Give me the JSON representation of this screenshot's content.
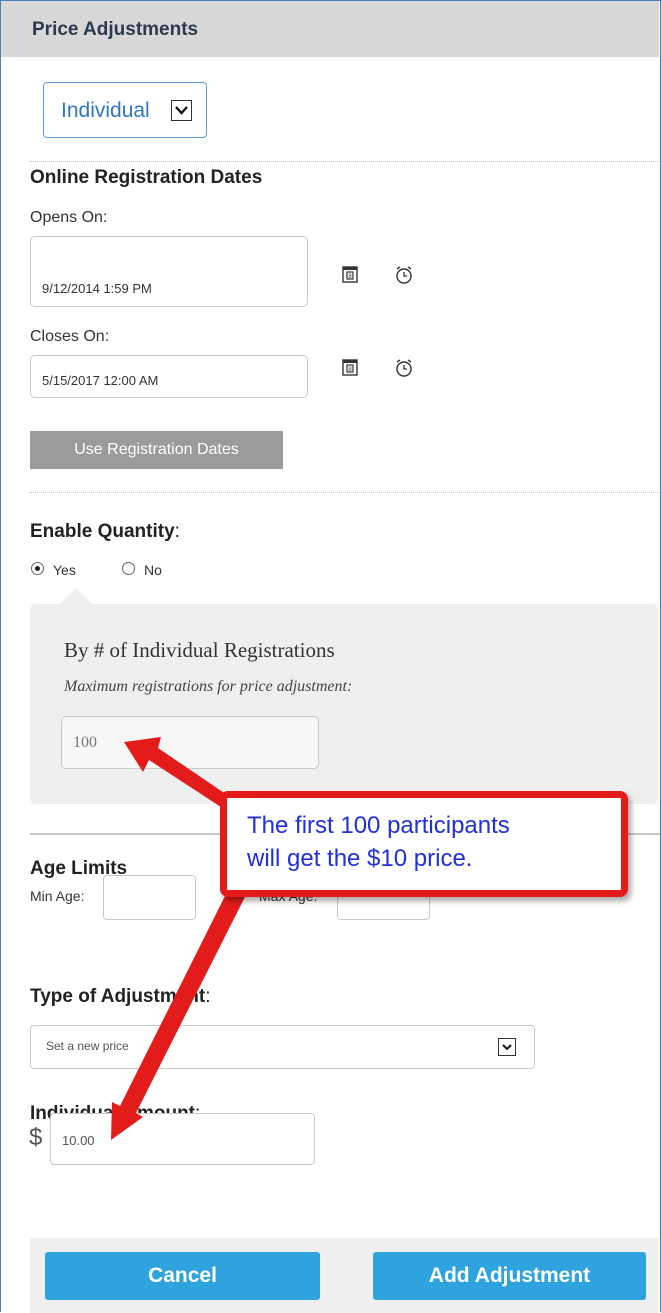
{
  "header": {
    "title": "Price Adjustments"
  },
  "registration_type": {
    "value": "Individual"
  },
  "online_dates": {
    "heading": "Online Registration Dates",
    "opens_label": "Opens On:",
    "opens_value": "9/12/2014 1:59 PM",
    "closes_label": "Closes On:",
    "closes_value": "5/15/2017 12:00 AM",
    "use_button": "Use Registration Dates"
  },
  "quantity": {
    "heading": "Enable Quantity",
    "colon": ":",
    "yes_label": "Yes",
    "no_label": "No",
    "selected": "Yes",
    "panel_title": "By # of Individual Registrations",
    "panel_subtitle": "Maximum registrations for price adjustment:",
    "max_value": "100"
  },
  "age_limits": {
    "heading": "Age Limits",
    "min_label": "Min Age:",
    "max_label": "Max Age:",
    "min_value": "",
    "max_value": ""
  },
  "adjustment_type": {
    "heading": "Type of Adjustment",
    "colon": ":",
    "value": "Set a new price"
  },
  "amount": {
    "heading": "Individual Amount",
    "colon": ":",
    "currency": "$",
    "value": "10.00"
  },
  "footer": {
    "cancel_label": "Cancel",
    "add_label": "Add Adjustment"
  },
  "callout": {
    "line1": "The first 100 participants",
    "line2": "will get the $10 price."
  },
  "colors": {
    "header_bg": "#d8d8d8",
    "button_blue": "#2fa3dd",
    "callout_red": "#e31b1b",
    "callout_text": "#1f2fdc"
  }
}
